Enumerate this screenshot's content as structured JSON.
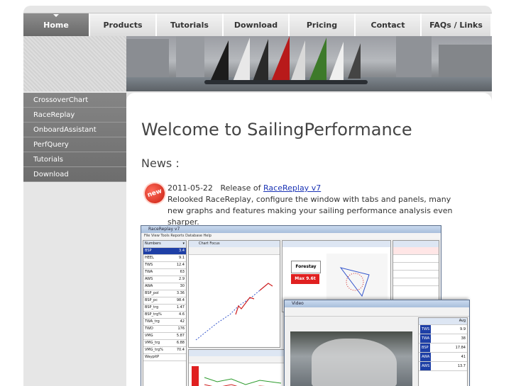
{
  "nav": {
    "items": [
      "Home",
      "Products",
      "Tutorials",
      "Download",
      "Pricing",
      "Contact",
      "FAQs / Links"
    ],
    "active": "Home"
  },
  "sidebar": {
    "items": [
      "CrossoverChart",
      "RaceReplay",
      "OnboardAssistant",
      "PerfQuery",
      "Tutorials",
      "Download"
    ]
  },
  "main": {
    "title": "Welcome to SailingPerformance",
    "news_heading": "News :",
    "news": {
      "badge": "new",
      "date": "2011-05-22",
      "release_prefix": "Release of",
      "link_text": "RaceReplay v7",
      "body": "Relooked RaceReplay, configure the window with tabs and panels, many new graphs and features making your sailing performance analysis even sharper."
    }
  },
  "screenshot": {
    "menu": "File  View  Tools  Reports  Database  Help",
    "chart_tab": "Chart Focus",
    "forestay_label": "Forestay",
    "forestay_value": "Max 9.6t",
    "video_title": "Video",
    "table_rows": [
      [
        "BSP",
        "3.4"
      ],
      [
        "HEEL",
        "9.1"
      ],
      [
        "TWS",
        "12.4"
      ],
      [
        "TWA",
        "63"
      ],
      [
        "AWS",
        "2.9"
      ],
      [
        "AWA",
        "30"
      ],
      [
        "BSP_pol",
        "3.36"
      ],
      [
        "BSP_pc",
        "98.4"
      ],
      [
        "BSP_trg",
        "1.47"
      ],
      [
        "BSP_trg%",
        "4.6"
      ],
      [
        "TWA_trg",
        "42"
      ],
      [
        "TWD",
        "176"
      ],
      [
        "VMG",
        "5.87"
      ],
      [
        "VMG_trg",
        "6.88"
      ],
      [
        "VMG_trg%",
        "70.4"
      ],
      [
        "WaypitP",
        ""
      ]
    ],
    "video_rows": [
      [
        "TWS",
        "9.9"
      ],
      [
        "TWA",
        "38"
      ],
      [
        "BSP",
        "17.84"
      ],
      [
        "AWA",
        "41"
      ],
      [
        "AWS",
        "13.7"
      ]
    ],
    "video_header": "Avg"
  },
  "colors": {
    "nav_active": "#7a7a7a",
    "sidebar_bg": "#7c7c7c",
    "link": "#1a33b5",
    "badge": "#d42a1a"
  }
}
